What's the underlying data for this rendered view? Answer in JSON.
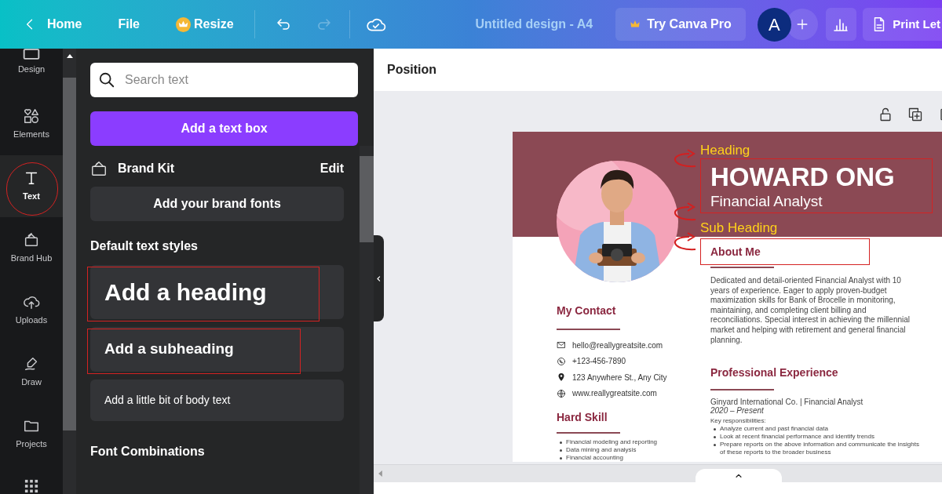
{
  "topbar": {
    "back": "Home",
    "menu": [
      "File"
    ],
    "resize": "Resize",
    "title": "Untitled design - A4",
    "pro": "Try Canva Pro",
    "avatar": "A",
    "print": "Print Let"
  },
  "rail": [
    {
      "label": "Design",
      "kind": "design",
      "selected": false,
      "highlighted": false
    },
    {
      "label": "Elements",
      "kind": "elements",
      "selected": false,
      "highlighted": false
    },
    {
      "label": "Text",
      "kind": "text",
      "selected": true,
      "highlighted": true
    },
    {
      "label": "Brand Hub",
      "kind": "brand",
      "selected": false,
      "highlighted": false
    },
    {
      "label": "Uploads",
      "kind": "uploads",
      "selected": false,
      "highlighted": false
    },
    {
      "label": "Draw",
      "kind": "draw",
      "selected": false,
      "highlighted": false
    },
    {
      "label": "Projects",
      "kind": "projects",
      "selected": false,
      "highlighted": false
    }
  ],
  "panel": {
    "search": {
      "placeholder": "Search text"
    },
    "add_text_box": "Add a text box",
    "brand_kit": {
      "title": "Brand Kit",
      "edit": "Edit",
      "add_fonts": "Add your brand fonts"
    },
    "default_styles_title": "Default text styles",
    "styles": [
      {
        "kind": "heading",
        "label": "Add a heading",
        "highlighted": true
      },
      {
        "kind": "subheading",
        "label": "Add a subheading",
        "highlighted": true
      },
      {
        "kind": "body",
        "label": "Add a little bit of body text",
        "highlighted": false
      }
    ],
    "font_combinations_title": "Font Combinations"
  },
  "canvas": {
    "toolbar": "Position",
    "resume": {
      "annotations": {
        "heading": "Heading",
        "subheading": "Sub Heading"
      },
      "name": "HOWARD ONG",
      "role": "Financial Analyst",
      "contact_title": "My Contact",
      "contacts": [
        {
          "kind": "email",
          "text": "hello@reallygreatsite.com"
        },
        {
          "kind": "phone",
          "text": "+123-456-7890"
        },
        {
          "kind": "address",
          "text": "123 Anywhere St., Any City"
        },
        {
          "kind": "web",
          "text": "www.reallygreatsite.com"
        }
      ],
      "skills_title": "Hard Skill",
      "skills": [
        "Financial modeling and reporting",
        "Data mining and analysis",
        "Financial accounting"
      ],
      "about_title": "About Me",
      "about": "Dedicated and detail-oriented Financial Analyst with 10 years of experience. Eager to apply proven-budget maximization skills for Bank of Brocelle in monitoring, maintaining, and completing client billing and reconciliations. Special interest in achieving the millennial market and helping with retirement and general financial planning.",
      "experience_title": "Professional Experience",
      "job": "Ginyard International Co. | Financial Analyst",
      "period": "2020 – Present",
      "resp_title": "Key responsibilities:",
      "responsibilities": [
        "Analyze current and past financial data",
        "Look at recent financial performance and identify trends",
        "Prepare reports on the above information and communicate the insights of these reports to the broader business"
      ]
    }
  }
}
